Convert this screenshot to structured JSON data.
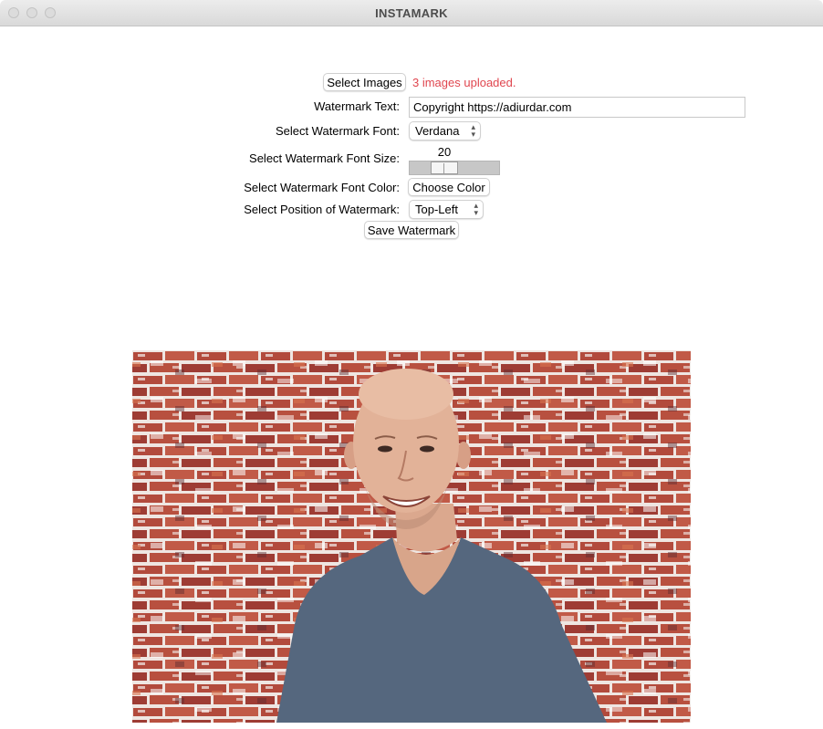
{
  "window": {
    "title": "INSTAMARK"
  },
  "form": {
    "select_images_label": "Select Images",
    "status_text": "3 images uploaded.",
    "watermark_text_label": "Watermark Text:",
    "watermark_text_value": "Copyright https://adiurdar.com",
    "font_label": "Select Watermark Font:",
    "font_value": "Verdana",
    "font_size_label": "Select Watermark Font Size:",
    "font_size_value": "20",
    "font_color_label": "Select Watermark Font Color:",
    "choose_color_label": "Choose Color",
    "position_label": "Select Position of Watermark:",
    "position_value": "Top-Left",
    "save_label": "Save Watermark"
  },
  "colors": {
    "status": "#e0464f",
    "brick": "#a8453a",
    "shirt": "#55677e"
  },
  "icons": {
    "select_chevron": "up-down-chevron-icon"
  }
}
